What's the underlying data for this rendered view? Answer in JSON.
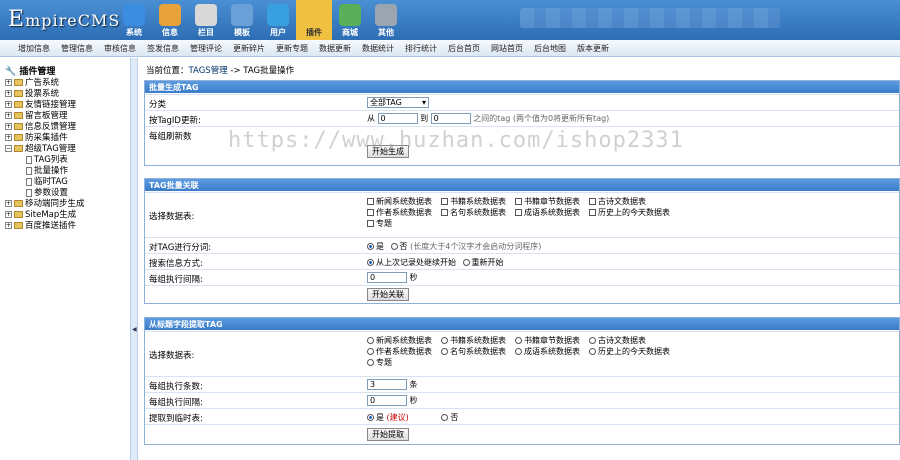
{
  "topbar": {
    "logo_e": "E",
    "logo_rest": "mpireCMS",
    "nav": [
      {
        "label": "系统",
        "icon": "globe-icon",
        "color": "#3a8de0"
      },
      {
        "label": "信息",
        "icon": "edit-icon",
        "color": "#e8a23a"
      },
      {
        "label": "栏目",
        "icon": "folder-icon",
        "color": "#d8d8d8"
      },
      {
        "label": "模板",
        "icon": "template-icon",
        "color": "#6aa0d8"
      },
      {
        "label": "用户",
        "icon": "user-icon",
        "color": "#39a0e0"
      },
      {
        "label": "插件",
        "icon": "plugin-icon",
        "color": "#f0c040"
      },
      {
        "label": "商城",
        "icon": "shop-icon",
        "color": "#5ab05a"
      },
      {
        "label": "其他",
        "icon": "gear-icon",
        "color": "#9aa5b0"
      }
    ]
  },
  "subnav": [
    "增加信息",
    "管理信息",
    "审核信息",
    "签发信息",
    "管理评论",
    "更新碎片",
    "更新专题",
    "数据更新",
    "数据统计",
    "排行统计",
    "后台首页",
    "网站首页",
    "后台地图",
    "版本更新"
  ],
  "sidebar": {
    "title": "插件管理",
    "items": [
      {
        "label": "广告系统",
        "type": "folder"
      },
      {
        "label": "投票系统",
        "type": "folder"
      },
      {
        "label": "友情链接管理",
        "type": "folder"
      },
      {
        "label": "留言板管理",
        "type": "folder"
      },
      {
        "label": "信息反馈管理",
        "type": "folder"
      },
      {
        "label": "防采集插件",
        "type": "folder"
      },
      {
        "label": "超级TAG管理",
        "type": "open"
      },
      {
        "label": "TAG列表",
        "type": "doc"
      },
      {
        "label": "批量操作",
        "type": "doc"
      },
      {
        "label": "临时TAG",
        "type": "doc"
      },
      {
        "label": "参数设置",
        "type": "doc"
      },
      {
        "label": "移动端同步生成",
        "type": "folder"
      },
      {
        "label": "SiteMap生成",
        "type": "folder"
      },
      {
        "label": "百度推送插件",
        "type": "folder"
      }
    ]
  },
  "crumb": {
    "prefix": "当前位置：",
    "link": "TAGS管理",
    "sep": " -> ",
    "current": "TAG批量操作"
  },
  "panel1": {
    "title": "批量生成TAG",
    "class_label": "分类",
    "class_value": "全部TAG",
    "id_label": "按TagID更新:",
    "from": "从",
    "from_val": "0",
    "to": "到",
    "to_val": "0",
    "id_hint": "之间的tag (两个值为0将更新所有tag)",
    "per_label": "每组刷新数",
    "button": "开始生成"
  },
  "panel2": {
    "title": "TAG批量关联",
    "db_label": "选择数据表:",
    "tables": [
      "新闻系统数据表",
      "书籍系统数据表",
      "书籍章节数据表",
      "古诗文数据表",
      "作者系统数据表",
      "名句系统数据表",
      "成语系统数据表",
      "历史上的今天数据表",
      "专题"
    ],
    "split_label": "对TAG进行分词:",
    "yes": "是",
    "no": "否",
    "split_hint": "(长度大于4个汉字才会启动分词程序)",
    "search_label": "搜索信息方式:",
    "resume": "从上次记录处继续开始",
    "restart": "重新开始",
    "interval_label": "每组执行间隔:",
    "interval_val": "0",
    "sec": "秒",
    "button": "开始关联"
  },
  "panel3": {
    "title": "从标题字段提取TAG",
    "db_label": "选择数据表:",
    "tables": [
      "新闻系统数据表",
      "书籍系统数据表",
      "书籍章节数据表",
      "古诗文数据表",
      "作者系统数据表",
      "名句系统数据表",
      "成语系统数据表",
      "历史上的今天数据表",
      "专题"
    ],
    "count_label": "每组执行条数:",
    "count_val": "3",
    "count_unit": "条",
    "interval_label": "每组执行间隔:",
    "interval_val": "0",
    "sec": "秒",
    "temp_label": "提取到临时表:",
    "yes": "是",
    "suggest": "(建议)",
    "no": "否",
    "button": "开始提取"
  },
  "watermark": "https://www.huzhan.com/ishop2331"
}
